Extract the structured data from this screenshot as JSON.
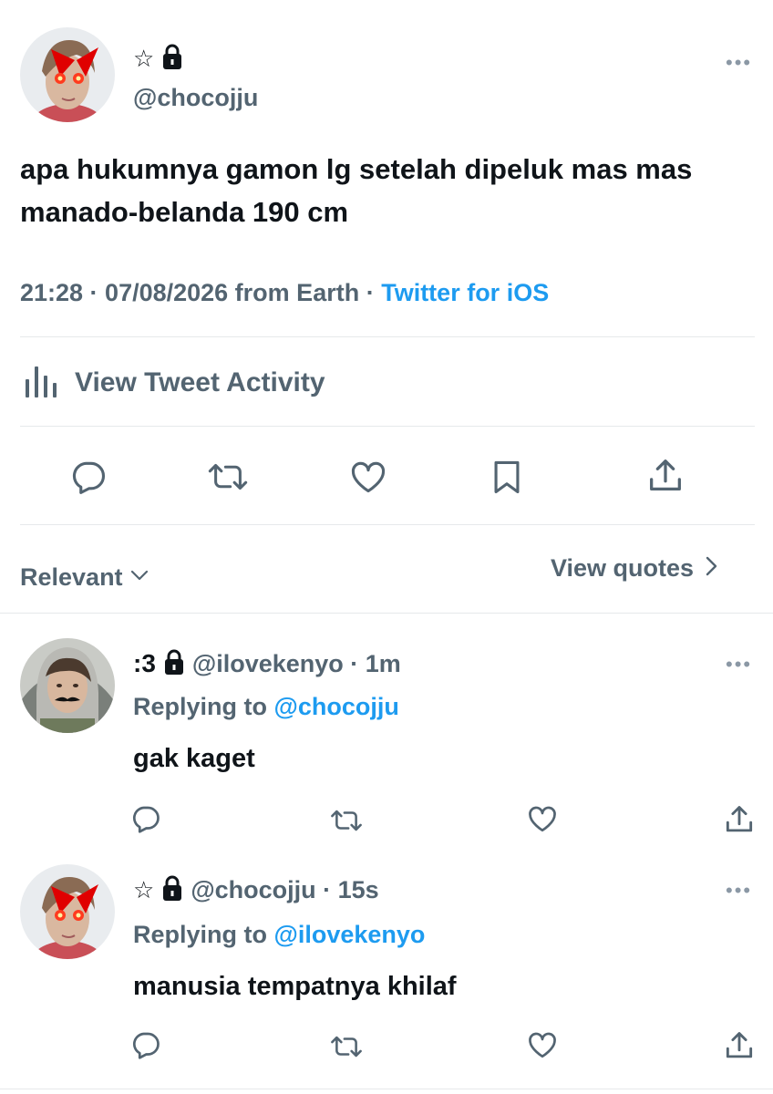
{
  "main_tweet": {
    "display_name": "☆",
    "handle": "@chocojju",
    "text": "apa hukumnya gamon lg setelah dipeluk mas mas manado-belanda 190 cm",
    "time": "21:28 · 07/08/2026 from Earth · ",
    "client": "Twitter for iOS",
    "more": "•••"
  },
  "activity": {
    "label": "View Tweet Activity"
  },
  "sort": {
    "relevant_label": "Relevant",
    "quotes_label": "View quotes"
  },
  "replies": [
    {
      "display_name": ":3",
      "handle_time": "@ilovekenyo · 1m",
      "replying_prefix": "Replying to ",
      "replying_to": "@chocojju",
      "text": "gak kaget",
      "more": "•••"
    },
    {
      "display_name": "☆",
      "handle_time": "@chocojju · 15s",
      "replying_prefix": "Replying to ",
      "replying_to": "@ilovekenyo",
      "text": "manusia tempatnya khilaf",
      "more": "•••"
    }
  ],
  "icons": {
    "reply": "reply-icon",
    "retweet": "retweet-icon",
    "like": "heart-icon",
    "bookmark": "bookmark-icon",
    "share": "share-icon",
    "lock": "lock-icon",
    "chevron": "chevron-icon",
    "activity": "bar-chart-icon"
  },
  "colors": {
    "link_blue": "#1d9bf0",
    "secondary_gray": "#536471",
    "icon_gray": "#536471"
  }
}
